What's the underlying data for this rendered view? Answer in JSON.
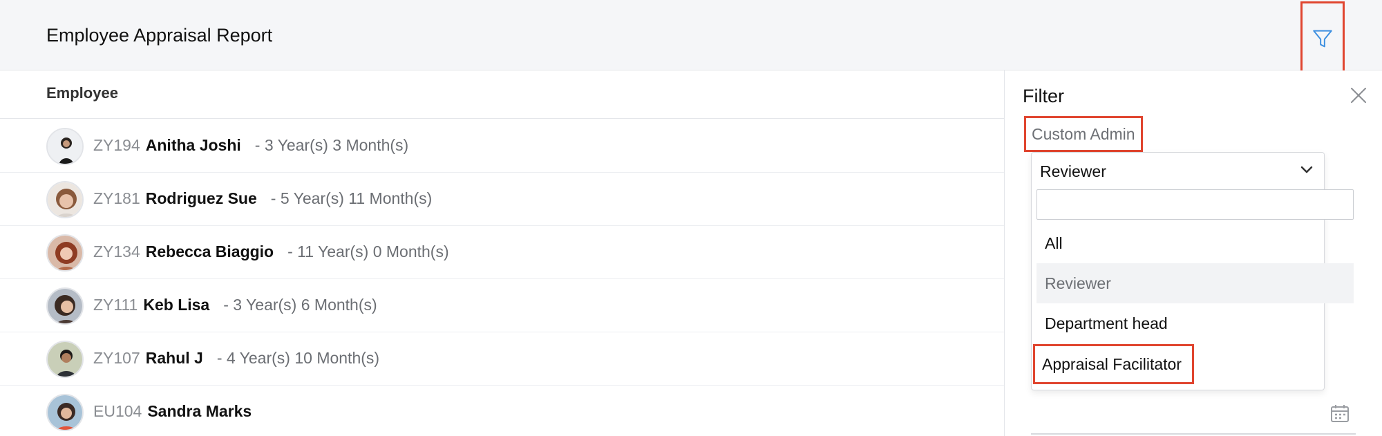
{
  "header": {
    "title": "Employee Appraisal Report",
    "filter_icon": "filter-funnel-icon"
  },
  "list": {
    "column_header": "Employee",
    "employees": [
      {
        "id": "ZY194",
        "name": "Anitha Joshi",
        "tenure": "- 3 Year(s) 3 Month(s)"
      },
      {
        "id": "ZY181",
        "name": "Rodriguez Sue",
        "tenure": "- 5 Year(s) 11 Month(s)"
      },
      {
        "id": "ZY134",
        "name": "Rebecca Biaggio",
        "tenure": "- 11 Year(s) 0 Month(s)"
      },
      {
        "id": "ZY111",
        "name": "Keb Lisa",
        "tenure": "- 3 Year(s) 6 Month(s)"
      },
      {
        "id": "ZY107",
        "name": "Rahul J",
        "tenure": "- 4 Year(s) 10 Month(s)"
      },
      {
        "id": "EU104",
        "name": "Sandra Marks",
        "tenure": ""
      }
    ]
  },
  "filter_panel": {
    "title": "Filter",
    "section_label": "Custom Admin",
    "dropdown": {
      "selected": "Reviewer",
      "search_value": "",
      "options": [
        "All",
        "Reviewer",
        "Department head",
        "Appraisal Facilitator"
      ]
    }
  },
  "colors": {
    "accent_blue": "#3d8fe0",
    "highlight_red": "#e0452f"
  }
}
